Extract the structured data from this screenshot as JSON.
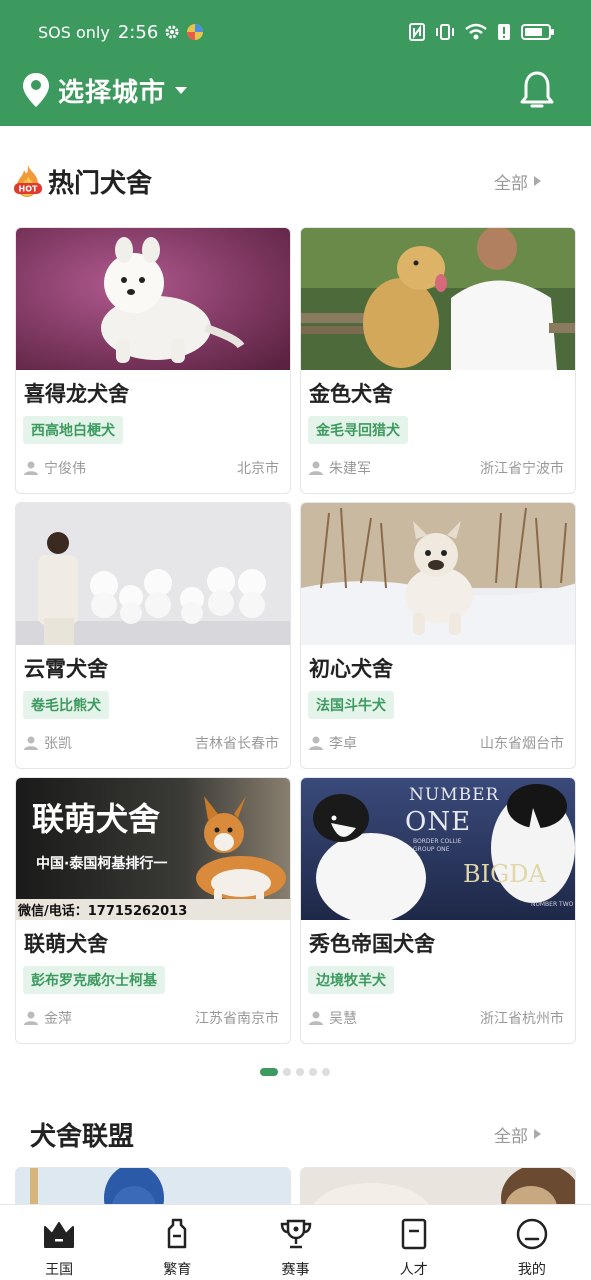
{
  "status_bar": {
    "network": "SOS only",
    "time": "2:56",
    "icons": [
      "gear-icon",
      "app-icon",
      "nfc-icon",
      "vibrate-icon",
      "wifi-icon",
      "alert-icon",
      "battery-icon"
    ]
  },
  "header": {
    "city_label": "选择城市",
    "icons": [
      "location-pin-icon",
      "dropdown-caret-icon",
      "bell-icon"
    ]
  },
  "hot_kennels": {
    "title": "热门犬舍",
    "badge_text": "HOT",
    "see_all": "全部",
    "cards": [
      {
        "name": "喜得龙犬舍",
        "breed": "西高地白梗犬",
        "owner": "宁俊伟",
        "city": "北京市",
        "image": "white-westie-photo"
      },
      {
        "name": "金色犬舍",
        "breed": "金毛寻回猎犬",
        "owner": "朱建军",
        "city": "浙江省宁波市",
        "image": "golden-retriever-photo"
      },
      {
        "name": "云霄犬舍",
        "breed": "卷毛比熊犬",
        "owner": "张凯",
        "city": "吉林省长春市",
        "image": "bichon-group-photo"
      },
      {
        "name": "初心犬舍",
        "breed": "法国斗牛犬",
        "owner": "李卓",
        "city": "山东省烟台市",
        "image": "french-bulldog-snow-photo"
      },
      {
        "name": "联萌犬舍",
        "breed": "彭布罗克威尔士柯基",
        "owner": "金萍",
        "city": "江苏省南京市",
        "image": "corgi-banner-photo"
      },
      {
        "name": "秀色帝国犬舍",
        "breed": "边境牧羊犬",
        "owner": "吴慧",
        "city": "浙江省杭州市",
        "image": "border-collie-banner-photo"
      }
    ],
    "banner_texts": {
      "corgi_title": "联萌犬舍",
      "corgi_sub": "中国·泰国柯基排行一",
      "corgi_contact": "微信/电话：17715262013",
      "collie_top": "NUMBER",
      "collie_one": "ONE",
      "collie_small": "BORDER COLLIE\nGROUP ONE",
      "collie_brand": "BIGDA",
      "collie_two": "NUMBER TWO"
    },
    "pager": {
      "count": 5,
      "active": 0
    }
  },
  "alliance": {
    "title": "犬舍联盟",
    "see_all": "全部"
  },
  "tabbar": {
    "tabs": [
      {
        "label": "王国",
        "icon": "crown-icon",
        "active": true
      },
      {
        "label": "繁育",
        "icon": "bottle-icon",
        "active": false
      },
      {
        "label": "赛事",
        "icon": "trophy-icon",
        "active": false
      },
      {
        "label": "人才",
        "icon": "document-icon",
        "active": false
      },
      {
        "label": "我的",
        "icon": "profile-face-icon",
        "active": false
      }
    ]
  },
  "colors": {
    "brand_green": "#3d9a5f",
    "tag_bg": "#e4f4ea",
    "muted_text": "#999999"
  }
}
